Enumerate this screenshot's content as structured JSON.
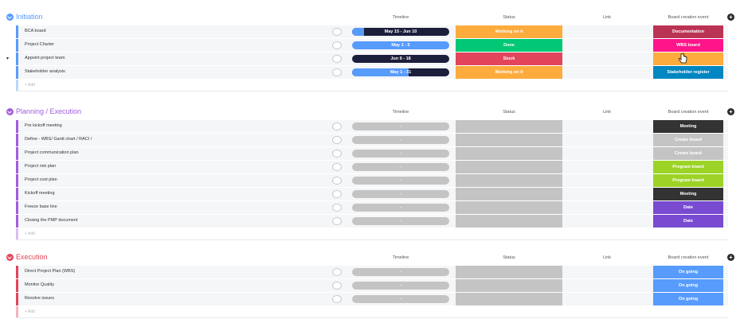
{
  "columns": {
    "timeline": "Timeline",
    "status": "Status",
    "link": "Link",
    "board": "Board creation event"
  },
  "colors": {
    "initiation": "#579bfc",
    "planning": "#a25ddc",
    "execution": "#e2445c"
  },
  "groups": [
    {
      "title": "Initiation",
      "color": "#579bfc",
      "add_label": "+ Add",
      "rows": [
        {
          "name": "BCA board",
          "timeline": "May 15 - Jun 10",
          "tl_style": "dark",
          "tl_fill": 0.12,
          "status": "Working on it",
          "status_color": "#fdab3d",
          "board": "Documentation",
          "board_color": "#bb3354"
        },
        {
          "name": "Project Charter",
          "timeline": "May 1 - 5",
          "tl_style": "blue",
          "tl_fill": 1.0,
          "status": "Done",
          "status_color": "#00c875",
          "board": "WBS board",
          "board_color": "#ff158a"
        },
        {
          "name": "Appoint project team",
          "timeline": "Jun 9 - 18",
          "tl_style": "dark",
          "tl_fill": 0,
          "status": "Stuck",
          "status_color": "#e2445c",
          "board": "",
          "board_color": "#fdab3d"
        },
        {
          "name": "Stakeholder analysis",
          "timeline": "May 1 - 31",
          "tl_style": "dark",
          "tl_fill": 0.58,
          "status": "Working on it",
          "status_color": "#fdab3d",
          "board": "Stakeholder register",
          "board_color": "#0086c0"
        }
      ]
    },
    {
      "title": "Planning / Execution",
      "color": "#a25ddc",
      "add_label": "+ Add",
      "rows": [
        {
          "name": "Pre kickoff meeting",
          "timeline": "-",
          "tl_style": "gray",
          "tl_fill": 0,
          "status": "",
          "status_color": "#c4c4c4",
          "board": "Meeting",
          "board_color": "#333333"
        },
        {
          "name": "Define - WBS/ Gantt chart / RACI /",
          "timeline": "-",
          "tl_style": "gray",
          "tl_fill": 0,
          "status": "",
          "status_color": "#c4c4c4",
          "board": "Create board",
          "board_color": "#c4c4c4"
        },
        {
          "name": "Project communication plan",
          "timeline": "-",
          "tl_style": "gray",
          "tl_fill": 0,
          "status": "",
          "status_color": "#c4c4c4",
          "board": "Create board",
          "board_color": "#c4c4c4"
        },
        {
          "name": "Project risk plan",
          "timeline": "-",
          "tl_style": "gray",
          "tl_fill": 0,
          "status": "",
          "status_color": "#c4c4c4",
          "board": "Program board",
          "board_color": "#9cd326"
        },
        {
          "name": "Project cost plan",
          "timeline": "-",
          "tl_style": "gray",
          "tl_fill": 0,
          "status": "",
          "status_color": "#c4c4c4",
          "board": "Program board",
          "board_color": "#9cd326"
        },
        {
          "name": "Kickoff meeting",
          "timeline": "-",
          "tl_style": "gray",
          "tl_fill": 0,
          "status": "",
          "status_color": "#c4c4c4",
          "board": "Meeting",
          "board_color": "#333333"
        },
        {
          "name": "Freeze base line",
          "timeline": "-",
          "tl_style": "gray",
          "tl_fill": 0,
          "status": "",
          "status_color": "#c4c4c4",
          "board": "Date",
          "board_color": "#784bd1"
        },
        {
          "name": "Closing the PMP document",
          "timeline": "-",
          "tl_style": "gray",
          "tl_fill": 0,
          "status": "",
          "status_color": "#c4c4c4",
          "board": "Date",
          "board_color": "#784bd1"
        }
      ]
    },
    {
      "title": "Execution",
      "color": "#e2445c",
      "add_label": "+ Add",
      "rows": [
        {
          "name": "Direct Project Plan (WBS)",
          "timeline": "-",
          "tl_style": "gray",
          "tl_fill": 0,
          "status": "",
          "status_color": "#c4c4c4",
          "board": "On going",
          "board_color": "#579bfc"
        },
        {
          "name": "Monitor Quality",
          "timeline": "-",
          "tl_style": "gray",
          "tl_fill": 0,
          "status": "",
          "status_color": "#c4c4c4",
          "board": "On going",
          "board_color": "#579bfc"
        },
        {
          "name": "Resolve issues",
          "timeline": "-",
          "tl_style": "gray",
          "tl_fill": 0,
          "status": "",
          "status_color": "#c4c4c4",
          "board": "On going",
          "board_color": "#579bfc"
        }
      ]
    }
  ]
}
